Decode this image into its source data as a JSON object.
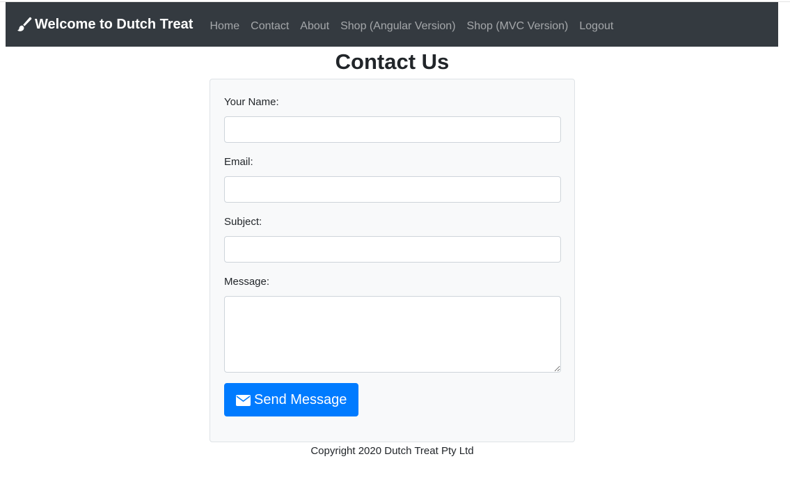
{
  "navbar": {
    "brand": {
      "label": "Welcome to Dutch Treat",
      "icon": "paint-brush-icon"
    },
    "links": [
      {
        "label": "Home"
      },
      {
        "label": "Contact"
      },
      {
        "label": "About"
      },
      {
        "label": "Shop (Angular Version)"
      },
      {
        "label": "Shop (MVC Version)"
      },
      {
        "label": "Logout"
      }
    ],
    "background": "#343a40"
  },
  "page": {
    "title": "Contact Us"
  },
  "form": {
    "name": {
      "label": "Your Name:",
      "value": ""
    },
    "email": {
      "label": "Email:",
      "value": ""
    },
    "subject": {
      "label": "Subject:",
      "value": ""
    },
    "message": {
      "label": "Message:",
      "value": ""
    },
    "submit": {
      "label": "Send Message",
      "icon": "envelope-icon",
      "color": "#007bff"
    }
  },
  "footer": {
    "text": "Copyright 2020 Dutch Treat Pty Ltd"
  }
}
